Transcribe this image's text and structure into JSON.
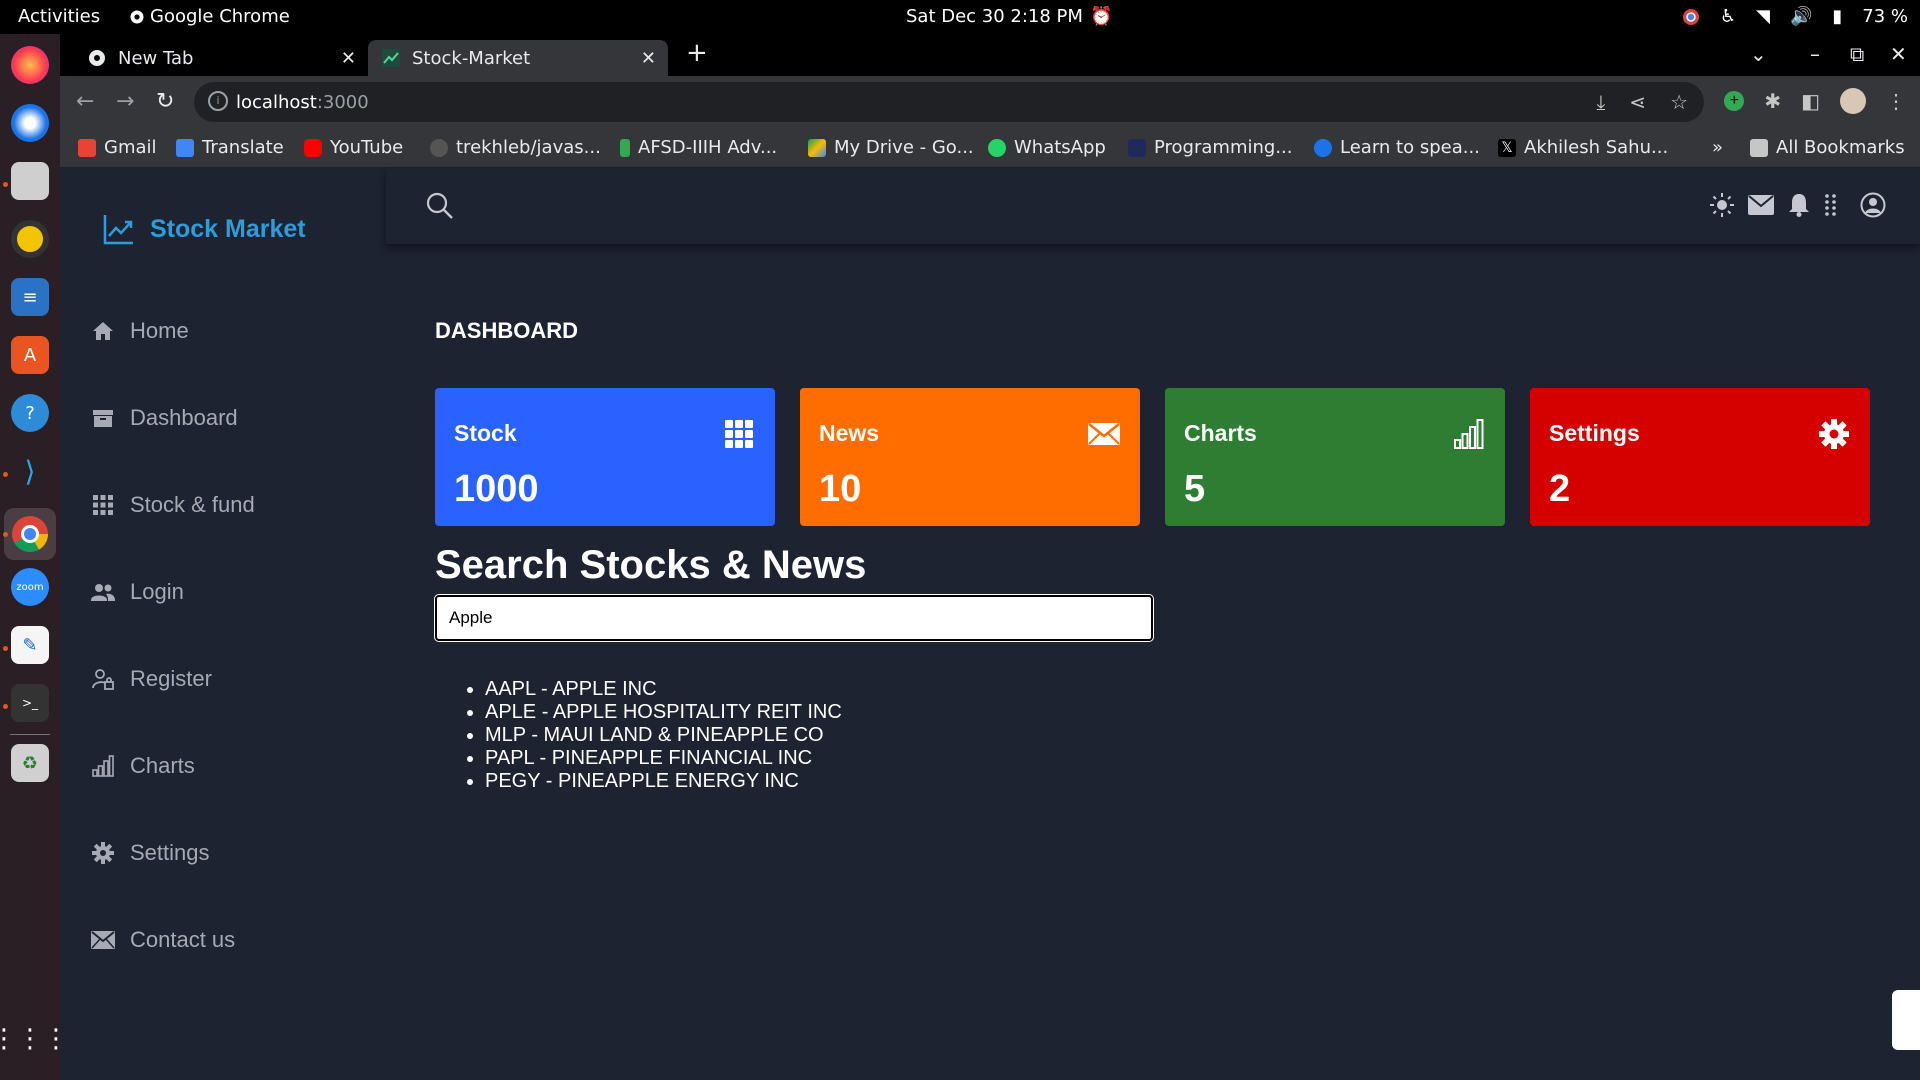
{
  "system": {
    "activities": "Activities",
    "app_name": "Google Chrome",
    "clock": "Sat Dec 30   2:18 PM",
    "battery": "73 %"
  },
  "browser": {
    "tabs": [
      {
        "label": "New Tab"
      },
      {
        "label": "Stock-Market"
      }
    ],
    "url_host": "localhost",
    "url_port": ":3000",
    "bookmarks": [
      {
        "label": "Gmail",
        "color": "#ea4335"
      },
      {
        "label": "Translate",
        "color": "#4285f4"
      },
      {
        "label": "YouTube",
        "color": "#ff0000"
      },
      {
        "label": "trekhleb/javas...",
        "color": "#555555"
      },
      {
        "label": "AFSD-IIIH Adv...",
        "color": "#34a853"
      },
      {
        "label": "My Drive - Go...",
        "color": "#fbbc04"
      },
      {
        "label": "WhatsApp",
        "color": "#25d366"
      },
      {
        "label": "Programming...",
        "color": "#1f2a5a"
      },
      {
        "label": "Learn to spea...",
        "color": "#1a73e8"
      },
      {
        "label": "Akhilesh Sahu...",
        "color": "#000000"
      }
    ],
    "bookmarks_overflow": "»",
    "all_bookmarks": "All Bookmarks"
  },
  "sidebar": {
    "brand": "Stock Market",
    "items": [
      {
        "label": "Home",
        "icon": "home-icon"
      },
      {
        "label": "Dashboard",
        "icon": "archive-icon"
      },
      {
        "label": "Stock & fund",
        "icon": "grid-icon"
      },
      {
        "label": "Login",
        "icon": "users-icon"
      },
      {
        "label": "Register",
        "icon": "user-lock-icon"
      },
      {
        "label": "Charts",
        "icon": "bar-chart-icon"
      },
      {
        "label": "Settings",
        "icon": "gear-icon"
      },
      {
        "label": "Contact us",
        "icon": "mail-icon"
      }
    ]
  },
  "dashboard": {
    "title": "DASHBOARD",
    "cards": [
      {
        "title": "Stock",
        "value": "1000",
        "color": "#2962ff",
        "icon": "grid-icon"
      },
      {
        "title": "News",
        "value": "10",
        "color": "#ff6d00",
        "icon": "mail-icon"
      },
      {
        "title": "Charts",
        "value": "5",
        "color": "#2e7d32",
        "icon": "bar-chart-icon"
      },
      {
        "title": "Settings",
        "value": "2",
        "color": "#d50000",
        "icon": "gear-icon"
      }
    ]
  },
  "search": {
    "title": "Search Stocks & News",
    "value": "Apple",
    "results": [
      "AAPL - APPLE INC",
      "APLE - APPLE HOSPITALITY REIT INC",
      "MLP - MAUI LAND & PINEAPPLE CO",
      "PAPL - PINEAPPLE FINANCIAL INC",
      "PEGY - PINEAPPLE ENERGY INC"
    ]
  }
}
